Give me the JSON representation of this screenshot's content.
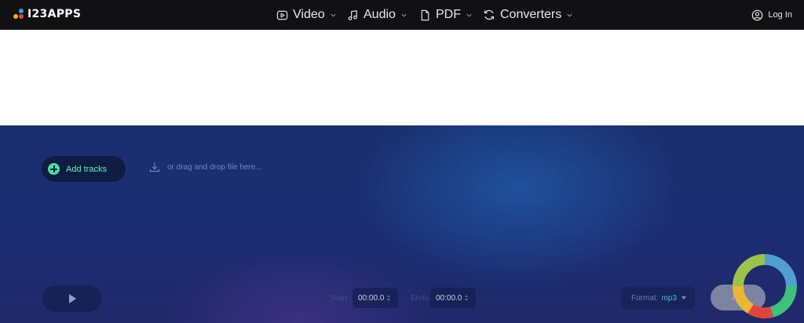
{
  "app": {
    "logo_text": "I23APPS"
  },
  "nav": {
    "items": [
      {
        "label": "Video",
        "icon": "play-square-icon"
      },
      {
        "label": "Audio",
        "icon": "music-note-icon"
      },
      {
        "label": "PDF",
        "icon": "document-icon"
      },
      {
        "label": "Converters",
        "icon": "refresh-icon"
      }
    ],
    "login_label": "Log In"
  },
  "editor": {
    "add_tracks_label": "Add tracks",
    "drop_hint": "or drag and drop file here...",
    "start_label": "Start",
    "start_value": "00:00.0",
    "end_label": "Ends",
    "end_value": "00:00.0",
    "format_label": "Format:",
    "format_value": "mp3",
    "join_label": "Join"
  },
  "colors": {
    "topbar_bg": "#111113",
    "accent_green": "#43e3a4",
    "format_accent": "#38c6d6"
  }
}
